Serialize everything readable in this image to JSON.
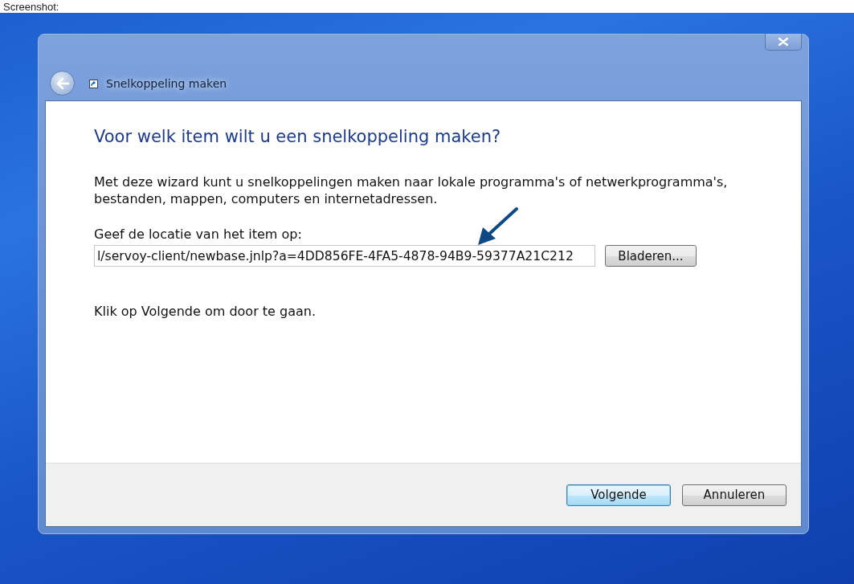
{
  "caption": "Screenshot:",
  "window": {
    "title": "Snelkoppeling maken"
  },
  "wizard": {
    "heading": "Voor welk item wilt u een snelkoppeling maken?",
    "description": "Met deze wizard kunt u snelkoppelingen maken naar lokale programma's of netwerkprogramma's, bestanden, mappen, computers en internetadressen.",
    "location_label": "Geef de locatie van het item op:",
    "location_value": "l/servoy-client/newbase.jnlp?a=4DD856FE-4FA5-4878-94B9-59377A21C212",
    "browse_button": "Bladeren...",
    "instruction": "Klik op Volgende om door te gaan."
  },
  "buttons": [
    {
      "label": "Volgende",
      "kind": "default"
    },
    {
      "label": "Annuleren",
      "kind": "normal"
    }
  ]
}
